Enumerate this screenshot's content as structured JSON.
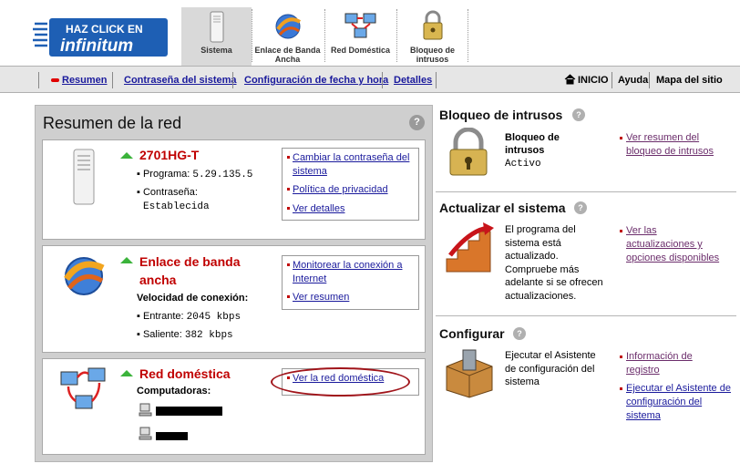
{
  "header": {
    "logo_line1": "HAZ CLICK EN",
    "logo_line2": "infinitum",
    "tabs": [
      {
        "label": "Sistema",
        "icon": "modem-icon",
        "active": true
      },
      {
        "label": "Enlace de Banda Ancha",
        "icon": "globe-icon",
        "active": false
      },
      {
        "label": "Red Doméstica",
        "icon": "network-computers-icon",
        "active": false
      },
      {
        "label": "Bloqueo de intrusos",
        "icon": "padlock-icon",
        "active": false
      }
    ]
  },
  "nav": {
    "links": [
      "Resumen",
      "Contraseña del sistema",
      "Configuración de fecha y hora",
      "Detalles"
    ],
    "home": "INICIO",
    "help": "Ayuda",
    "sitemap": "Mapa del sitio"
  },
  "summary": {
    "title": "Resumen de la red",
    "help_glyph": "?",
    "device": {
      "name": "2701HG-T",
      "program_label": "Programa:",
      "program_value": "5.29.135.5",
      "password_label": "Contraseña:",
      "password_value": "Establecida",
      "links": [
        "Cambiar la contraseña del sistema",
        "Política de privacidad",
        "Ver detalles"
      ]
    },
    "broadband": {
      "name": "Enlace de banda ancha",
      "speed_label": "Velocidad de conexión:",
      "incoming_label": "Entrante:",
      "incoming_value": "2045 kbps",
      "outgoing_label": "Saliente:",
      "outgoing_value": "382 kbps",
      "links": [
        "Monitorear la conexión a Internet",
        "Ver resumen"
      ]
    },
    "home_network": {
      "name": "Red doméstica",
      "computers_label": "Computadoras:",
      "links": [
        "Ver la red doméstica"
      ]
    }
  },
  "intrusion": {
    "title": "Bloqueo de intrusos",
    "label": "Bloqueo de intrusos",
    "status": "Activo",
    "link": "Ver resumen del bloqueo de intrusos"
  },
  "update": {
    "title": "Actualizar el sistema",
    "text": "El programa del sistema está actualizado. Compruebe más adelante si se ofrecen actualizaciones.",
    "link": "Ver las actualizaciones y opciones disponibles"
  },
  "configure": {
    "title": "Configurar",
    "text": "Ejecutar el Asistente de configuración del sistema",
    "links": [
      "Información de registro",
      "Ejecutar el Asistente de configuración del sistema"
    ]
  },
  "colors": {
    "accent_red": "#c00000",
    "link_blue": "#1a1a9c",
    "visited": "#6b2d6b",
    "arrow_green": "#3bb33b"
  }
}
